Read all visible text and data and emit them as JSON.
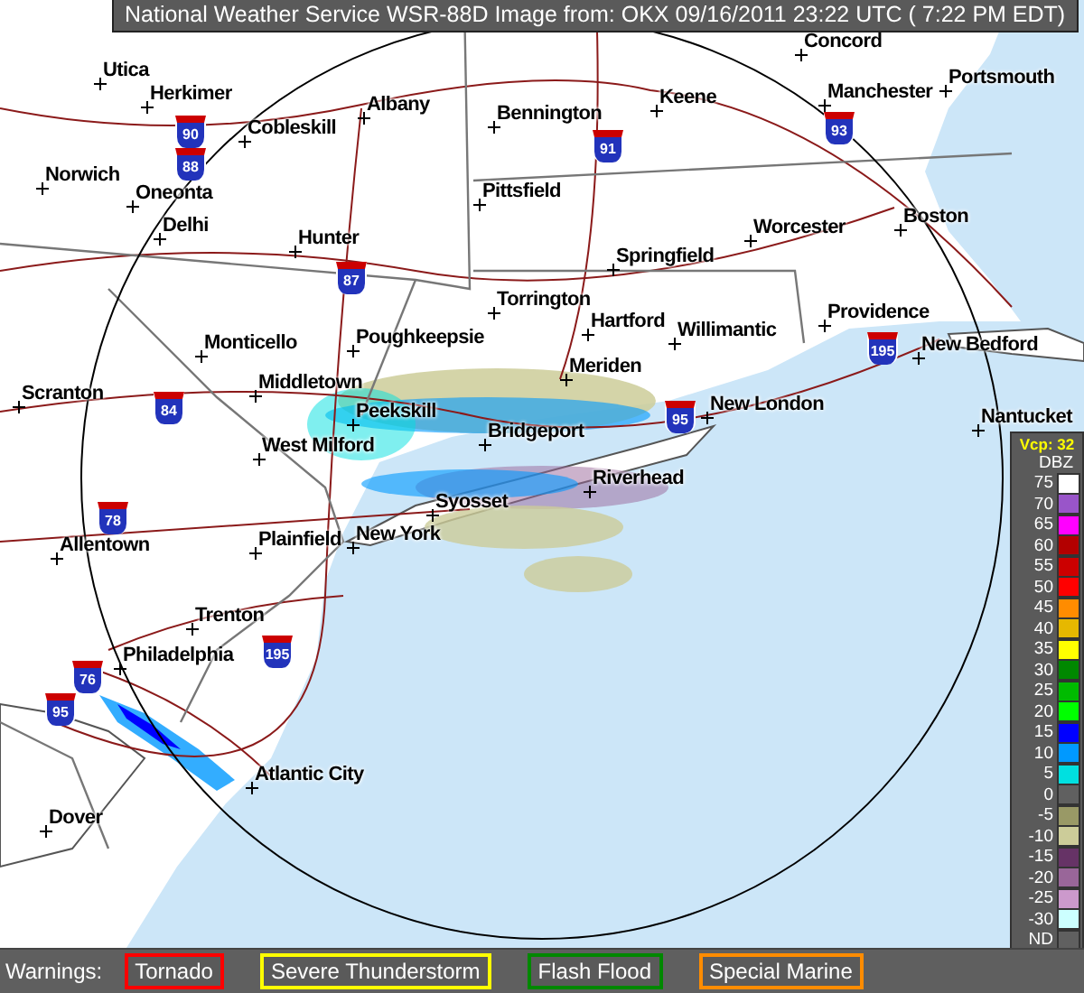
{
  "title_bar": {
    "text": "National Weather Service WSR-88D Image from: OKX 09/16/2011 23:22 UTC ( 7:22 PM EDT)"
  },
  "map": {
    "cities": [
      {
        "name": "Concord"
      },
      {
        "name": "Utica"
      },
      {
        "name": "Herkimer"
      },
      {
        "name": "Bennington"
      },
      {
        "name": "Keene"
      },
      {
        "name": "Manchester"
      },
      {
        "name": "Portsmouth"
      },
      {
        "name": "Cobleskill"
      },
      {
        "name": "Albany"
      },
      {
        "name": "Norwich"
      },
      {
        "name": "Oneonta"
      },
      {
        "name": "Pittsfield"
      },
      {
        "name": "Delhi"
      },
      {
        "name": "Worcester"
      },
      {
        "name": "Boston"
      },
      {
        "name": "Hunter"
      },
      {
        "name": "Springfield"
      },
      {
        "name": "Torrington"
      },
      {
        "name": "Hartford"
      },
      {
        "name": "Willimantic"
      },
      {
        "name": "Providence"
      },
      {
        "name": "Monticello"
      },
      {
        "name": "Poughkeepsie"
      },
      {
        "name": "New Bedford"
      },
      {
        "name": "Middletown"
      },
      {
        "name": "Meriden"
      },
      {
        "name": "New London"
      },
      {
        "name": "Nantucket"
      },
      {
        "name": "Scranton"
      },
      {
        "name": "Peekskill"
      },
      {
        "name": "West Milford"
      },
      {
        "name": "Bridgeport"
      },
      {
        "name": "Syosset"
      },
      {
        "name": "Riverhead"
      },
      {
        "name": "Allentown"
      },
      {
        "name": "Plainfield"
      },
      {
        "name": "New York"
      },
      {
        "name": "Trenton"
      },
      {
        "name": "Philadelphia"
      },
      {
        "name": "Atlantic City"
      },
      {
        "name": "Dover"
      }
    ],
    "interstates": [
      {
        "number": "90"
      },
      {
        "number": "91"
      },
      {
        "number": "93"
      },
      {
        "number": "88"
      },
      {
        "number": "87"
      },
      {
        "number": "84"
      },
      {
        "number": "95"
      },
      {
        "number": "195"
      },
      {
        "number": "78"
      },
      {
        "number": "195"
      },
      {
        "number": "76"
      },
      {
        "number": "95"
      }
    ]
  },
  "legend": {
    "mode": "Vcp: 32",
    "unit": "DBZ",
    "levels": [
      {
        "label": "75",
        "color": "#ffffff"
      },
      {
        "label": "70",
        "color": "#9955c9"
      },
      {
        "label": "65",
        "color": "#ff00ff"
      },
      {
        "label": "60",
        "color": "#b30000"
      },
      {
        "label": "55",
        "color": "#cc0000"
      },
      {
        "label": "50",
        "color": "#ff0000"
      },
      {
        "label": "45",
        "color": "#ff8c00"
      },
      {
        "label": "40",
        "color": "#e6b800"
      },
      {
        "label": "35",
        "color": "#ffff00"
      },
      {
        "label": "30",
        "color": "#008800"
      },
      {
        "label": "25",
        "color": "#00bb00"
      },
      {
        "label": "20",
        "color": "#00ff00"
      },
      {
        "label": "15",
        "color": "#0000ff"
      },
      {
        "label": "10",
        "color": "#0099ff"
      },
      {
        "label": "5",
        "color": "#00e0e0"
      },
      {
        "label": "0",
        "color": "#606060"
      },
      {
        "label": "-5",
        "color": "#999966"
      },
      {
        "label": "-10",
        "color": "#cccc99"
      },
      {
        "label": "-15",
        "color": "#663366"
      },
      {
        "label": "-20",
        "color": "#996699"
      },
      {
        "label": "-25",
        "color": "#cc99cc"
      },
      {
        "label": "-30",
        "color": "#ccffff"
      },
      {
        "label": "ND",
        "color": "#606060"
      }
    ]
  },
  "warnings": {
    "label": "Warnings:",
    "items": [
      {
        "label": "Tornado",
        "color": "#ff0000"
      },
      {
        "label": "Severe Thunderstorm",
        "color": "#ffff00"
      },
      {
        "label": "Flash Flood",
        "color": "#008800"
      },
      {
        "label": "Special Marine",
        "color": "#ff8c00"
      }
    ]
  }
}
